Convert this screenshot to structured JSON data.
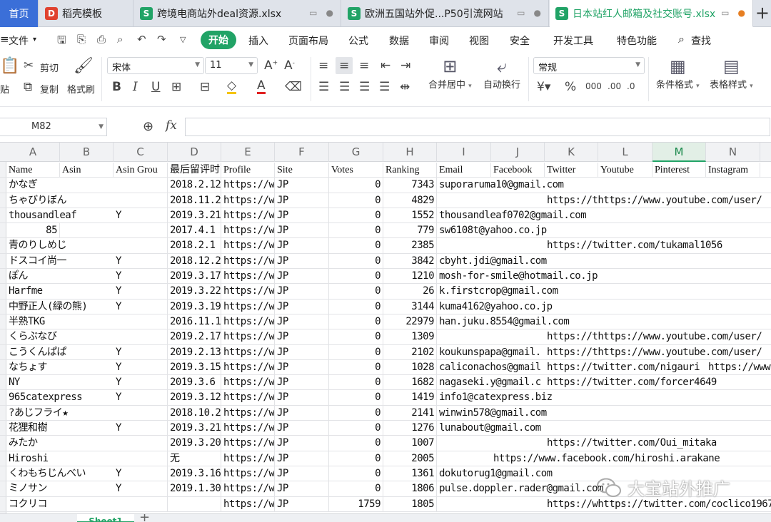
{
  "tabs": {
    "home": "首页",
    "items": [
      {
        "label": "稻壳模板",
        "icon": "docer-icon",
        "color": "#e0422f",
        "glyph": "D"
      },
      {
        "label": "跨境电商站外deal资源.xlsx",
        "icon": "sheet-file-icon",
        "color": "#21a366",
        "glyph": "S"
      },
      {
        "label": "欧洲五国站外促...P50引流网站",
        "icon": "sheet-file-icon",
        "color": "#21a366",
        "glyph": "S"
      },
      {
        "label": "日本站红人邮箱及社交账号.xlsx",
        "icon": "sheet-file-icon",
        "color": "#21a366",
        "glyph": "S"
      }
    ],
    "plus": "+"
  },
  "menu": {
    "file": "文件",
    "start": "开始",
    "items": [
      "插入",
      "页面布局",
      "公式",
      "数据",
      "审阅",
      "视图",
      "安全",
      "开发工具",
      "特色功能"
    ],
    "search": "查找"
  },
  "ribbon": {
    "paste": "贴",
    "cut": "剪切",
    "copy": "复制",
    "format_painter": "格式刷",
    "font_name": "宋体",
    "font_size": "11",
    "merge_center": "合并居中",
    "wrap_text": "自动换行",
    "number_format": "常规",
    "conditional_format": "条件格式",
    "table_style": "表格样式"
  },
  "formula_bar": {
    "name_box": "M82",
    "fx": "fx",
    "value": ""
  },
  "columns": [
    "A",
    "B",
    "C",
    "D",
    "E",
    "F",
    "G",
    "H",
    "I",
    "J",
    "K",
    "L",
    "M",
    "N"
  ],
  "selected_column": "M",
  "header_row": [
    "Name",
    "Asin",
    "Asin Grou",
    "最后留评时",
    "Profile",
    "Site",
    "Votes",
    "Ranking",
    "Email",
    "Facebook",
    "Twitter",
    "Youtube",
    "Pinterest",
    "Instagram"
  ],
  "rows": [
    {
      "a": "かなぎ",
      "c": "",
      "d": "2018.2.12",
      "e": "https://w",
      "f": "JP",
      "g": "0",
      "h": "7343",
      "i": "suporaruma10@gmail.com",
      "j": "",
      "k": "",
      "n": ""
    },
    {
      "a": "ちゃびりぼん",
      "c": "",
      "d": "2018.11.2",
      "e": "https://w",
      "f": "JP",
      "g": "0",
      "h": "4829",
      "i": "",
      "j": "",
      "k": "https://thttps://www.youtube.com/user/",
      "n": ""
    },
    {
      "a": "thousandleaf",
      "c": "Y",
      "d": "2019.3.21",
      "e": "https://w",
      "f": "JP",
      "g": "0",
      "h": "1552",
      "i": "thousandleaf0702@gmail.com",
      "j": "",
      "k": "",
      "n": ""
    },
    {
      "a": "85",
      "a_num": true,
      "c": "",
      "d": "2017.4.1",
      "e": "https://w",
      "f": "JP",
      "g": "0",
      "h": "779",
      "i": "sw6108t@yahoo.co.jp",
      "j": "",
      "k": "",
      "n": ""
    },
    {
      "a": "青のりしめじ",
      "c": "",
      "d": "2018.2.1",
      "e": "https://w",
      "f": "JP",
      "g": "0",
      "h": "2385",
      "i": "",
      "j": "",
      "k": "https://twitter.com/tukamal1056",
      "n": ""
    },
    {
      "a": "ドスコイ尚一",
      "c": "Y",
      "d": "2018.12.2",
      "e": "https://w",
      "f": "JP",
      "g": "0",
      "h": "3842",
      "i": "cbyht.jdi@gmail.com",
      "j": "",
      "k": "",
      "n": ""
    },
    {
      "a": "ぽん",
      "c": "Y",
      "d": "2019.3.17",
      "e": "https://w",
      "f": "JP",
      "g": "0",
      "h": "1210",
      "i": "mosh-for-smile@hotmail.co.jp",
      "j": "",
      "k": "",
      "n": ""
    },
    {
      "a": "Harfme",
      "c": "Y",
      "d": "2019.3.22",
      "e": "https://w",
      "f": "JP",
      "g": "0",
      "h": "26",
      "i": "k.firstcrop@gmail.com",
      "j": "",
      "k": "",
      "n": ""
    },
    {
      "a": "中野正人(緑の熊)",
      "c": "Y",
      "d": "2019.3.19",
      "e": "https://w",
      "f": "JP",
      "g": "0",
      "h": "3144",
      "i": "kuma4162@yahoo.co.jp",
      "j": "",
      "k": "",
      "n": ""
    },
    {
      "a": "半熟TKG",
      "c": "",
      "d": "2016.11.1",
      "e": "https://w",
      "f": "JP",
      "g": "0",
      "h": "22979",
      "i": "han.juku.8554@gmail.com",
      "j": "",
      "k": "",
      "n": ""
    },
    {
      "a": "くらぶなび",
      "c": "",
      "d": "2019.2.17",
      "e": "https://w",
      "f": "JP",
      "g": "0",
      "h": "1309",
      "i": "",
      "j": "",
      "k": "https://thttps://www.youtube.com/user/",
      "n": ""
    },
    {
      "a": "こうくんぱぱ",
      "c": "Y",
      "d": "2019.2.13",
      "e": "https://w",
      "f": "JP",
      "g": "0",
      "h": "2102",
      "i": "koukunspapa@gmail.",
      "j": "",
      "k": "https://thttps://www.youtube.com/user/",
      "n": ""
    },
    {
      "a": "なちょす",
      "c": "Y",
      "d": "2019.3.15",
      "e": "https://w",
      "f": "JP",
      "g": "0",
      "h": "1028",
      "i": "caliconachos@gmail",
      "j": "",
      "k": "https://twitter.com/nigauri",
      "n": "https://www"
    },
    {
      "a": "NY",
      "c": "Y",
      "d": "2019.3.6",
      "e": "https://w",
      "f": "JP",
      "g": "0",
      "h": "1682",
      "i": "nagaseki.y@gmail.c",
      "j": "",
      "k": "https://twitter.com/forcer4649",
      "n": ""
    },
    {
      "a": "965catexpress",
      "c": "Y",
      "d": "2019.3.12",
      "e": "https://w",
      "f": "JP",
      "g": "0",
      "h": "1419",
      "i": "info1@catexpress.biz",
      "j": "",
      "k": "",
      "n": ""
    },
    {
      "a": "?あじフライ★",
      "c": "",
      "d": "2018.10.2",
      "e": "https://w",
      "f": "JP",
      "g": "0",
      "h": "2141",
      "i": "winwin578@gmail.com",
      "j": "",
      "k": "",
      "n": ""
    },
    {
      "a": "花狸和樹",
      "c": "Y",
      "d": "2019.3.21",
      "e": "https://w",
      "f": "JP",
      "g": "0",
      "h": "1276",
      "i": "lunabout@gmail.com",
      "j": "",
      "k": "",
      "n": ""
    },
    {
      "a": "みたか",
      "c": "",
      "d": "2019.3.20",
      "e": "https://w",
      "f": "JP",
      "g": "0",
      "h": "1007",
      "i": "",
      "j": "",
      "k": "https://twitter.com/Oui_mitaka",
      "n": ""
    },
    {
      "a": "Hiroshi",
      "c": "",
      "d": "无",
      "e": "https://w",
      "f": "JP",
      "g": "0",
      "h": "2005",
      "i": "",
      "j": "https://www.facebook.com/hiroshi.arakane",
      "k": "",
      "n": ""
    },
    {
      "a": "くわもちじんべい",
      "c": "Y",
      "d": "2019.3.16",
      "e": "https://w",
      "f": "JP",
      "g": "0",
      "h": "1361",
      "i": "dokutorug1@gmail.com",
      "j": "",
      "k": "",
      "n": ""
    },
    {
      "a": "ミノサン",
      "c": "Y",
      "d": "2019.1.30",
      "e": "https://w",
      "f": "JP",
      "g": "0",
      "h": "1806",
      "i": "pulse.doppler.rader@gmail.com",
      "j": "",
      "k": "",
      "n": ""
    },
    {
      "a": "コクリコ",
      "c": "",
      "d": "",
      "e": "https://w",
      "f": "JP",
      "g": "1759",
      "h": "1805",
      "i": "",
      "j": "",
      "k": "https://whttps://twitter.com/coclico1967",
      "n": ""
    }
  ],
  "sheet": {
    "name": "Sheet1",
    "add": "+"
  },
  "watermark": "大宝站外推广",
  "colors": {
    "accent": "#21a366",
    "home_tab": "#3b6fd8",
    "selected_col": "#e2efe6"
  }
}
